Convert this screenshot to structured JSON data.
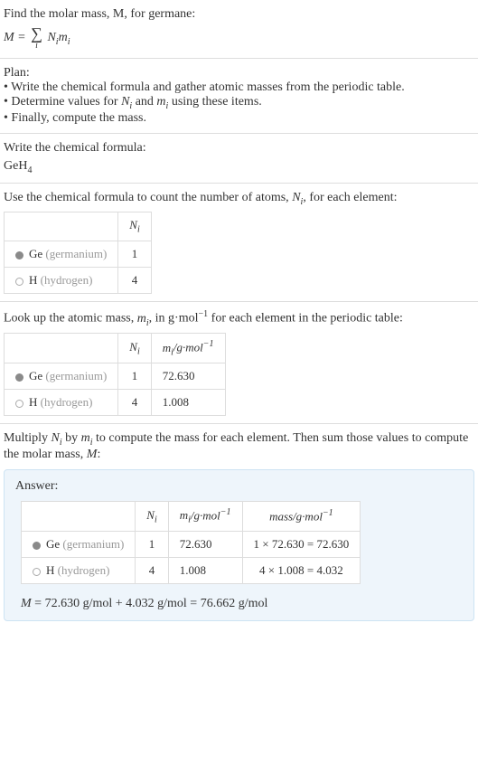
{
  "intro": {
    "line": "Find the molar mass, M, for germane:",
    "formula_lhs": "M = ",
    "formula_rhs_after_sum": " N",
    "formula_sub1": "i",
    "formula_mid": "m",
    "formula_sub2": "i"
  },
  "plan": {
    "heading": "Plan:",
    "b1": "• Write the chemical formula and gather atomic masses from the periodic table.",
    "b2_a": "• Determine values for ",
    "b2_ni": "N",
    "b2_ni_sub": "i",
    "b2_b": " and ",
    "b2_mi": "m",
    "b2_mi_sub": "i",
    "b2_c": " using these items.",
    "b3": "• Finally, compute the mass."
  },
  "chem": {
    "line": "Write the chemical formula:",
    "formula_main": "GeH",
    "formula_sub": "4"
  },
  "count": {
    "line_a": "Use the chemical formula to count the number of atoms, ",
    "ni": "N",
    "ni_sub": "i",
    "line_b": ", for each element:",
    "h_ni": "N",
    "h_ni_sub": "i",
    "rows": [
      {
        "sym": "Ge",
        "name": "(germanium)",
        "n": "1",
        "dot": "ge"
      },
      {
        "sym": "H",
        "name": "(hydrogen)",
        "n": "4",
        "dot": "h"
      }
    ]
  },
  "mass": {
    "line_a": "Look up the atomic mass, ",
    "mi": "m",
    "mi_sub": "i",
    "line_b": ", in g·mol",
    "exp": "−1",
    "line_c": " for each element in the periodic table:",
    "h_ni": "N",
    "h_ni_sub": "i",
    "h_mi": "m",
    "h_mi_sub": "i",
    "h_unit_a": "/g·mol",
    "h_unit_exp": "−1",
    "rows": [
      {
        "sym": "Ge",
        "name": "(germanium)",
        "n": "1",
        "m": "72.630",
        "dot": "ge"
      },
      {
        "sym": "H",
        "name": "(hydrogen)",
        "n": "4",
        "m": "1.008",
        "dot": "h"
      }
    ]
  },
  "compute": {
    "line_a": "Multiply ",
    "ni": "N",
    "ni_sub": "i",
    "line_b": " by ",
    "mi": "m",
    "mi_sub": "i",
    "line_c": " to compute the mass for each element. Then sum those values to compute the molar mass, ",
    "mvar": "M",
    "line_d": ":"
  },
  "answer": {
    "label": "Answer:",
    "h_ni": "N",
    "h_ni_sub": "i",
    "h_mi": "m",
    "h_mi_sub": "i",
    "h_unit_a": "/g·mol",
    "h_unit_exp": "−1",
    "h_mass_a": "mass/g·mol",
    "h_mass_exp": "−1",
    "rows": [
      {
        "sym": "Ge",
        "name": "(germanium)",
        "n": "1",
        "m": "72.630",
        "calc": "1 × 72.630 = 72.630",
        "dot": "ge"
      },
      {
        "sym": "H",
        "name": "(hydrogen)",
        "n": "4",
        "m": "1.008",
        "calc": "4 × 1.008 = 4.032",
        "dot": "h"
      }
    ],
    "result_a": "M",
    "result_b": " = 72.630 g/mol + 4.032 g/mol = 76.662 g/mol"
  },
  "chart_data": {
    "type": "table",
    "elements": [
      {
        "element": "Ge",
        "name": "germanium",
        "N_i": 1,
        "m_i_g_per_mol": 72.63,
        "mass_g_per_mol": 72.63
      },
      {
        "element": "H",
        "name": "hydrogen",
        "N_i": 4,
        "m_i_g_per_mol": 1.008,
        "mass_g_per_mol": 4.032
      }
    ],
    "molar_mass_g_per_mol": 76.662,
    "compound": "GeH4"
  }
}
